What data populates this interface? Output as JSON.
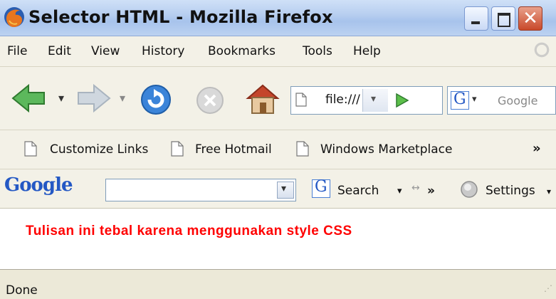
{
  "window": {
    "title": "Selector HTML - Mozilla Firefox",
    "icon": "firefox-icon",
    "controls": [
      "minimize-icon",
      "maximize-icon",
      "close-icon"
    ],
    "close_glyph": "✕"
  },
  "menu": {
    "items": [
      "File",
      "Edit",
      "View",
      "History",
      "Bookmarks",
      "Tools",
      "Help"
    ]
  },
  "navigation": {
    "buttons": [
      "back-arrow-icon",
      "forward-arrow-icon",
      "reload-icon",
      "stop-icon",
      "home-icon"
    ],
    "dropdown_glyph": "▾",
    "url": "file:///",
    "go_icon": "play-icon",
    "search_engine_glyph": "G",
    "search_placeholder": "Google"
  },
  "bookmarks": {
    "items": [
      "Customize Links",
      "Free Hotmail",
      "Windows Marketplace"
    ],
    "overflow_glyph": "»"
  },
  "google_toolbar": {
    "logo": "Google",
    "search_label": "Search",
    "search_dropdown_glyph": "▾",
    "overflow_glyph": "»",
    "settings_label": "Settings",
    "settings_dropdown_glyph": "▾"
  },
  "content": {
    "text": "Tulisan ini tebal karena menggunakan style CSS",
    "text_color": "#ff0000"
  },
  "status": {
    "text": "Done"
  },
  "colors": {
    "titlebar": "#b8cff0",
    "chrome": "#f3f1e7",
    "close_button": "#c9492a"
  }
}
